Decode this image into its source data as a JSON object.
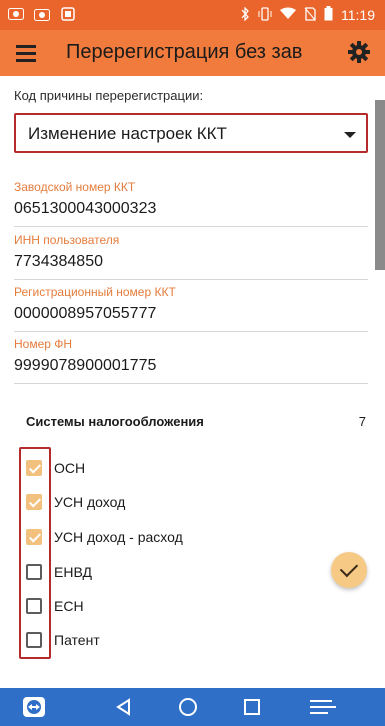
{
  "status_bar": {
    "time": "11:19",
    "icons": [
      "eye-icon",
      "camera-icon",
      "square-icon",
      "bluetooth-icon",
      "vibrate-icon",
      "wifi-icon",
      "no-sim-icon",
      "battery-icon"
    ]
  },
  "app_bar": {
    "title": "Перерегистрация без зав",
    "menu_icon": "hamburger-menu-icon",
    "settings_icon": "gear-icon"
  },
  "form": {
    "reason_label": "Код причины перерегистрации:",
    "reason_value": "Изменение настроек ККТ",
    "fields": [
      {
        "label": "Заводской номер ККТ",
        "value": "0651300043000323"
      },
      {
        "label": "ИНН пользователя",
        "value": "7734384850"
      },
      {
        "label": "Регистрационный номер ККТ",
        "value": "0000008957055777"
      },
      {
        "label": "Номер ФН",
        "value": "9999078900001775"
      }
    ]
  },
  "tax_systems": {
    "header": "Системы налогообложения",
    "count": "7",
    "items": [
      {
        "label": "ОСН",
        "checked": true
      },
      {
        "label": "УСН доход",
        "checked": true
      },
      {
        "label": "УСН доход - расход",
        "checked": true
      },
      {
        "label": "ЕНВД",
        "checked": false
      },
      {
        "label": "ЕСН",
        "checked": false
      },
      {
        "label": "Патент",
        "checked": false
      }
    ]
  },
  "fab": {
    "icon": "check-icon"
  },
  "nav_bar": {
    "icons": [
      "teamviewer-icon",
      "back-icon",
      "home-icon",
      "recents-icon",
      "menu-lines-icon"
    ]
  },
  "colors": {
    "status_bar": "#e9652b",
    "app_bar": "#f07b3c",
    "accent_label": "#e47c3c",
    "highlight_outline": "#b52a2a",
    "checked": "#f3c17e",
    "nav_bar": "#2f6fc8"
  }
}
